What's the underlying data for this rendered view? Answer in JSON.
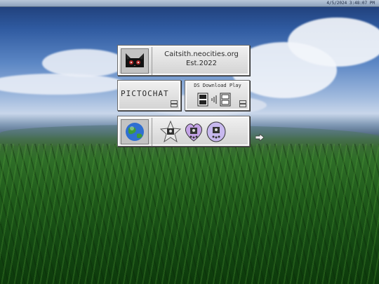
{
  "status_bar": {
    "clock": "4/5/2024 3:48:07 PM"
  },
  "site": {
    "name": "Caitsith.neocities.org",
    "established": "Est.2022"
  },
  "apps": {
    "pictochat": {
      "label": "PICTOCHAT"
    },
    "download_play": {
      "label": "DS Download Play"
    }
  },
  "icons": {
    "profile": "black-cat-icon",
    "globe": "globe-icon",
    "badges": [
      "star-tamagotchi-icon",
      "heart-tamagotchi-icon",
      "round-tamagotchi-icon"
    ],
    "next": "arrow-right-icon"
  },
  "colors": {
    "panel": "#e4e4e4",
    "panel_border": "#6a6a6a",
    "text": "#2b2b2b",
    "sky": "#2f5aa0",
    "grass": "#1f5a1a"
  }
}
